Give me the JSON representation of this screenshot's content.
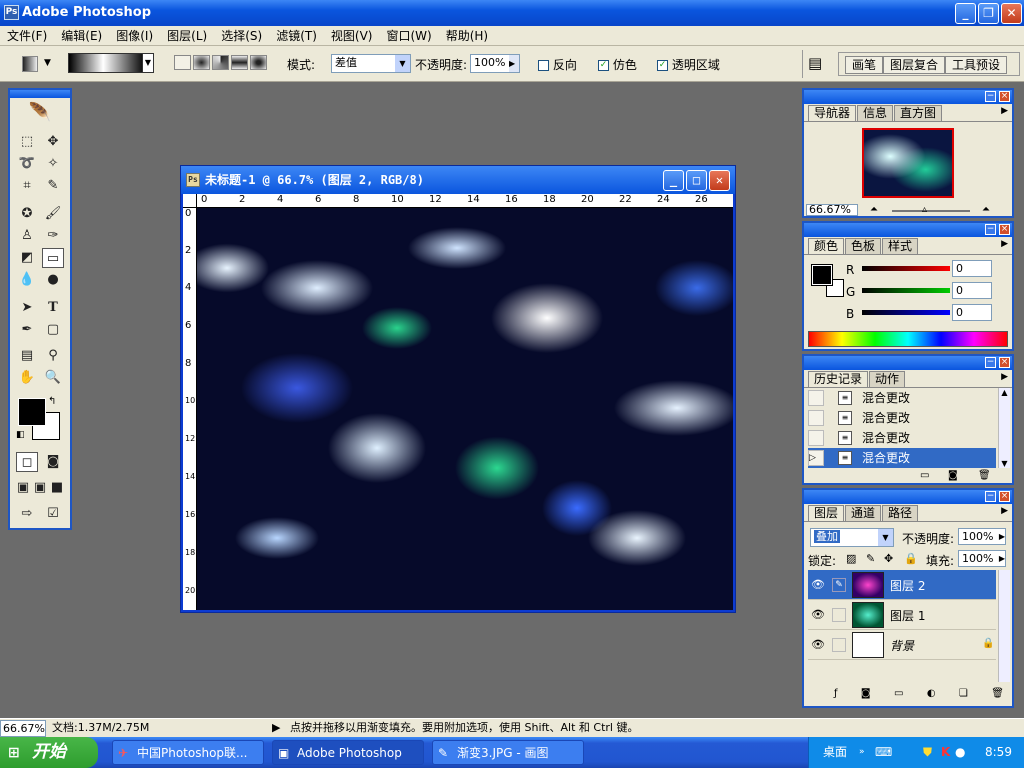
{
  "app": {
    "title": "Adobe Photoshop"
  },
  "menu": [
    "文件(F)",
    "编辑(E)",
    "图像(I)",
    "图层(L)",
    "选择(S)",
    "滤镜(T)",
    "视图(V)",
    "窗口(W)",
    "帮助(H)"
  ],
  "options": {
    "mode_label": "模式:",
    "mode_value": "差值",
    "opacity_label": "不透明度:",
    "opacity_value": "100%",
    "reverse_label": "反向",
    "dither_label": "仿色",
    "transparency_label": "透明区域",
    "dither_checked": "✓",
    "transparency_checked": "✓",
    "tab_brush": "画笔",
    "tab_layer_comps": "图层复合",
    "tab_tool_presets": "工具预设"
  },
  "document": {
    "title": "未标题-1 @ 66.7% (图层 2, RGB/8)",
    "ruler_top": [
      "0",
      "2",
      "4",
      "6",
      "8",
      "10",
      "12",
      "14",
      "16",
      "18",
      "20",
      "22",
      "24",
      "26"
    ],
    "ruler_left": [
      "0",
      "2",
      "4",
      "6",
      "8",
      "10",
      "12",
      "14",
      "16",
      "18",
      "20"
    ]
  },
  "navigator": {
    "tabs": [
      "导航器",
      "信息",
      "直方图"
    ],
    "zoom": "66.67%"
  },
  "color": {
    "tabs": [
      "颜色",
      "色板",
      "样式"
    ],
    "r_label": "R",
    "g_label": "G",
    "b_label": "B",
    "r_value": "0",
    "g_value": "0",
    "b_value": "0"
  },
  "history": {
    "tabs": [
      "历史记录",
      "动作"
    ],
    "items": [
      "混合更改",
      "混合更改",
      "混合更改",
      "混合更改"
    ]
  },
  "layers": {
    "tabs": [
      "图层",
      "通道",
      "路径"
    ],
    "blend_mode": "叠加",
    "opacity_label": "不透明度:",
    "opacity_value": "100%",
    "lock_label": "锁定:",
    "fill_label": "填充:",
    "fill_value": "100%",
    "items": [
      {
        "name": "图层 2"
      },
      {
        "name": "图层 1"
      },
      {
        "name": "背景"
      }
    ]
  },
  "status": {
    "zoom": "66.67%",
    "doc_size": "文档:1.37M/2.75M",
    "hint": "点按并拖移以用渐变填充。要用附加选项，使用 Shift、Alt 和 Ctrl 键。"
  },
  "taskbar": {
    "start": "开始",
    "tasks": [
      "中国Photoshop联...",
      "Adobe Photoshop",
      "渐变3.JPG - 画图"
    ],
    "desktop": "桌面",
    "time": "8:59"
  }
}
